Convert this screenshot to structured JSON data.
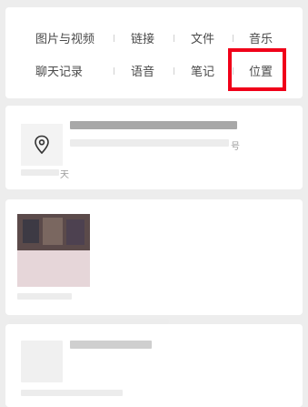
{
  "filters": {
    "row1": [
      "图片与视频",
      "链接",
      "文件",
      "音乐"
    ],
    "row2": [
      "聊天记录",
      "语音",
      "笔记",
      "位置"
    ]
  },
  "location_card": {
    "suffix": "号",
    "time_suffix": "天"
  },
  "colors": {
    "highlight": "#f00019",
    "background": "#ededed",
    "card": "#ffffff",
    "text": "#4a4a4a"
  }
}
